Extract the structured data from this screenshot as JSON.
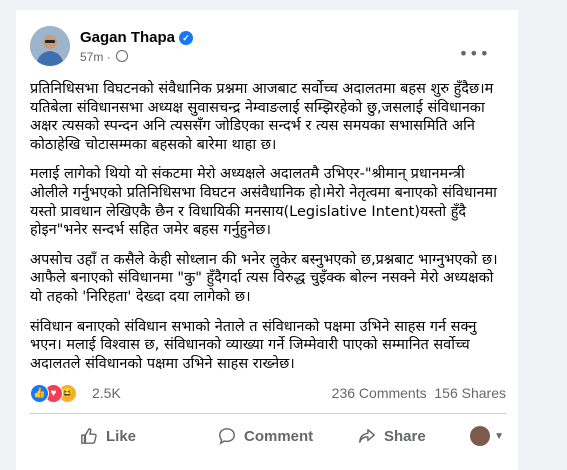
{
  "post": {
    "author": "Gagan Thapa",
    "time": "57m",
    "separator": "·",
    "paragraphs": [
      "प्रतिनिधिसभा विघटनको संवैधानिक प्रश्नमा आजबाट सर्वोच्च अदालतमा बहस शुरु हुँदैछ।म यतिबेला संविधानसभा अध्यक्ष सुवासचन्द्र नेम्वाङलाई सम्झिरहेको छु,जसलाई संविधानका अक्षर त्यसको स्पन्दन अनि त्यससँग जोडिएका सन्दर्भ र त्यस समयका सभासमिति अनि कोठाहेखि चोटासम्मका बहसको बारेमा थाहा छ।",
      "मलाई लागेको थियो यो संकटमा मेरो अध्यक्षले अदालतमै उभिएर-\"श्रीमान् प्रधानमन्त्री ओलीले गर्नुभएको प्रतिनिधिसभा विघटन असंवैधानिक हो।मेरो नेतृत्वमा बनाएको संविधानमा यस्तो प्रावधान लेखिएकै छैन र विधायिकी मनसाय(Legislative Intent)यस्तो हुँदै होइन\"भनेर सन्दर्भ सहित जमेर बहस गर्नुहुनेछ।",
      "अपसोच उहाँ त कसैले केही सोध्लान की भनेर लुकेर बस्नुभएको छ,प्रश्नबाट भाग्नुभएको छ।आफैले बनाएको संविधानमा \"कु\" हुँदैगर्दा त्यस विरुद्ध चुइँक्क बोल्न नसक्ने मेरो अध्यक्षको यो तहको 'निरिहता' देख्दा दया लागेको छ।",
      "संविधान बनाएको संविधान सभाको नेताले त संविधानको पक्षमा उभिने साहस गर्न सक्नु भएन। मलाई विश्वास छ, संविधानको व्याख्या गर्ने जिम्मेवारी पाएको सम्मानित सर्वोच्च अदालतले संविधानको पक्षमा उभिने साहस राख्नेछ।"
    ]
  },
  "engagement": {
    "reactions": "2.5K",
    "comments": "236 Comments",
    "shares": "156 Shares"
  },
  "actions": {
    "like": "Like",
    "comment": "Comment",
    "share": "Share"
  },
  "colors": {
    "like": "#1877f2",
    "love": "#f33e58",
    "haha": "#f7b125"
  }
}
